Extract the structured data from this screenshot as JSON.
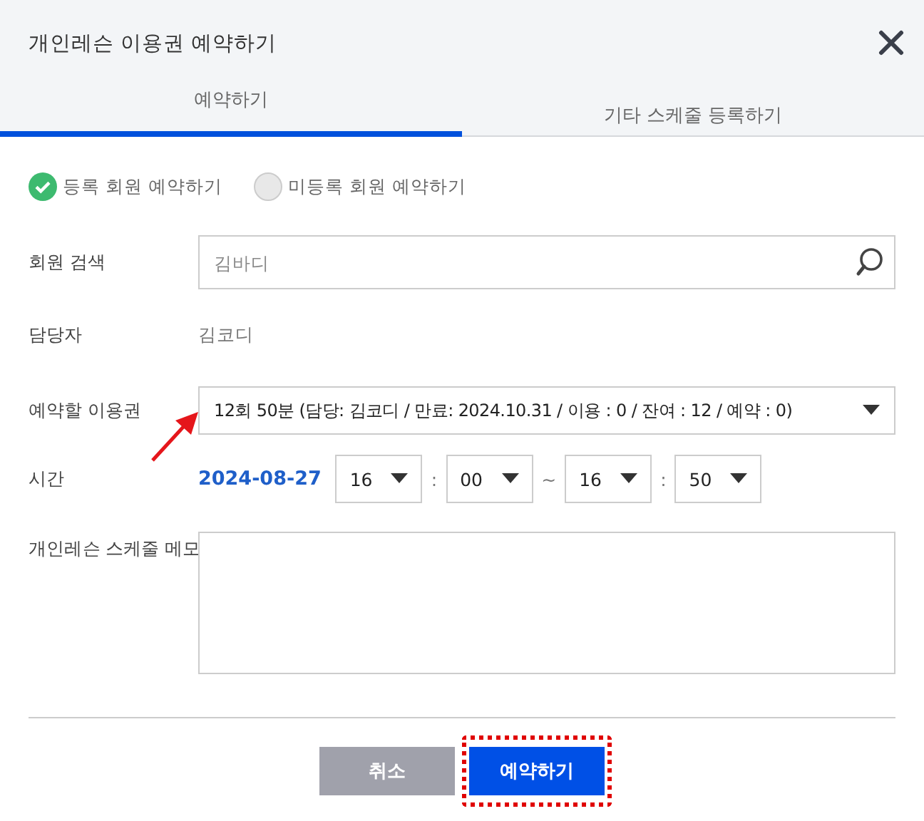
{
  "window": {
    "title": "개인레슨 이용권 예약하기"
  },
  "tabs": [
    {
      "label": "예약하기",
      "selected": true
    },
    {
      "label": "기타 스케줄 등록하기",
      "selected": false
    }
  ],
  "member_type": [
    {
      "label": "등록 회원 예약하기",
      "selected": true
    },
    {
      "label": "미등록 회원 예약하기",
      "selected": false
    }
  ],
  "form": {
    "member_search": {
      "label": "회원 검색",
      "placeholder": "김바디"
    },
    "manager": {
      "label": "담당자",
      "value": "김코디"
    },
    "ticket": {
      "label": "예약할 이용권",
      "value": "12회 50분 (담당: 김코디 / 만료: 2024.10.31 / 이용 : 0 / 잔여 : 12 / 예약 : 0)"
    },
    "time": {
      "label": "시간",
      "date": "2024-08-27",
      "parts": [
        {
          "kind": "select",
          "value": "16"
        },
        {
          "kind": "text",
          "value": ":"
        },
        {
          "kind": "select",
          "value": "00"
        },
        {
          "kind": "text",
          "value": "~"
        },
        {
          "kind": "select",
          "value": "16"
        },
        {
          "kind": "text",
          "value": ":"
        },
        {
          "kind": "select",
          "value": "50"
        }
      ]
    },
    "memo": {
      "label": "개인레슨 스케줄 메모"
    }
  },
  "buttons": [
    {
      "kind": "cancel",
      "label": "취소",
      "highlighted": false
    },
    {
      "kind": "primary",
      "label": "예약하기",
      "highlighted": true
    }
  ],
  "annotations": [
    {
      "kind": "arrow"
    }
  ]
}
